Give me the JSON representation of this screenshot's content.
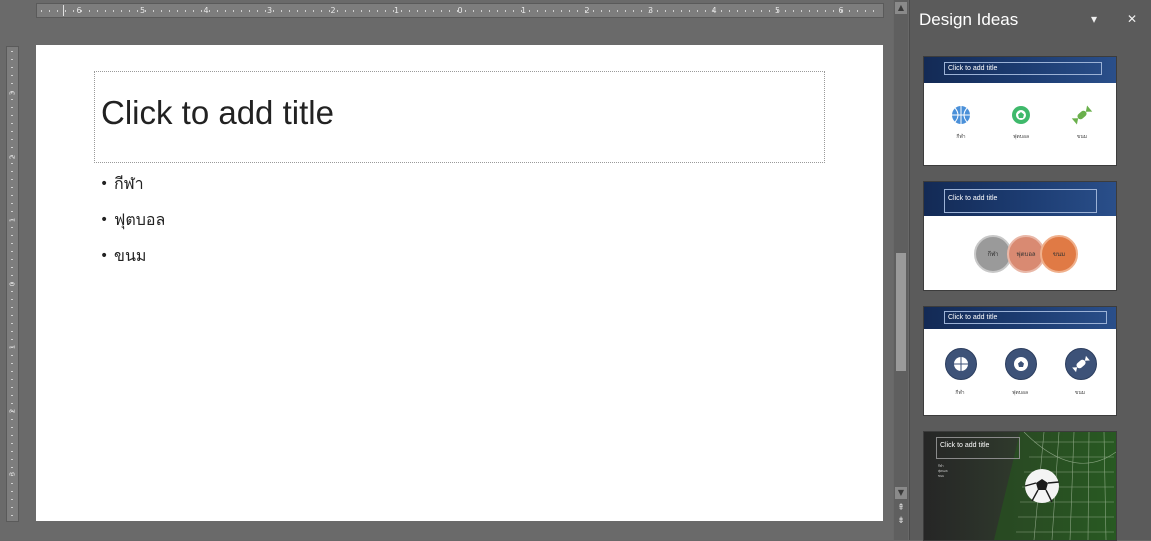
{
  "ruler": {
    "horizontal_numbers": [
      "6",
      "5",
      "4",
      "3",
      "2",
      "1",
      "0",
      "1",
      "2",
      "3",
      "4",
      "5",
      "6"
    ],
    "vertical_numbers": [
      "3",
      "2",
      "1",
      "0",
      "1",
      "2",
      "3"
    ]
  },
  "slide": {
    "title_placeholder": "Click to add title",
    "bullets": [
      "กีฬา",
      "ฟุตบอล",
      "ขนม"
    ]
  },
  "scrollbar": {
    "up_arrow": "▲",
    "down_arrow": "▼",
    "prev_slide": "⇞",
    "next_slide": "⇟"
  },
  "design_ideas": {
    "title": "Design Ideas",
    "dropdown_glyph": "▾",
    "close_glyph": "✕",
    "thumbnails": [
      {
        "title": "Click to add title",
        "labels": [
          "กีฬา",
          "ฟุตบอล",
          "ขนม"
        ],
        "icons": [
          "basketball-icon",
          "soccer-ball-icon",
          "candy-icon"
        ]
      },
      {
        "title": "Click to add title",
        "labels": [
          "กีฬา",
          "ฟุตบอล",
          "ขนม"
        ]
      },
      {
        "title": "Click to add title",
        "labels": [
          "กีฬา",
          "ฟุตบอล",
          "ขนม"
        ],
        "icons": [
          "basketball-icon",
          "soccer-ball-icon",
          "candy-icon"
        ]
      },
      {
        "title": "Click to add title",
        "bullets": [
          "กีฬา",
          "ฟุตบอล",
          "ขนม"
        ]
      }
    ]
  },
  "colors": {
    "accent_blue": "#1d3d73",
    "icon_blue": "#4a90d9",
    "icon_green": "#3fb96b",
    "pill_grey": "#9a9a9a",
    "pill_rose": "#d98a72",
    "pill_orange": "#e07a45"
  }
}
